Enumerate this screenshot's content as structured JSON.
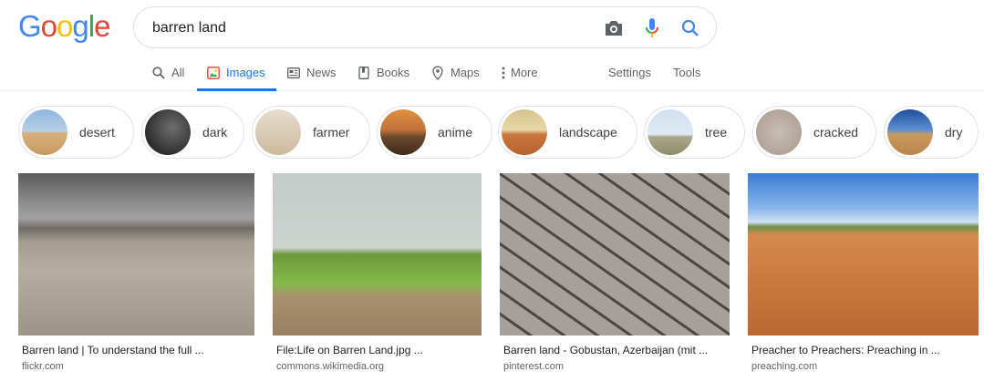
{
  "logo": {
    "letters": [
      "G",
      "o",
      "o",
      "g",
      "l",
      "e"
    ],
    "colors": [
      "#4285F4",
      "#EA4335",
      "#FBBC05",
      "#4285F4",
      "#34A853",
      "#EA4335"
    ]
  },
  "search": {
    "value": "barren land",
    "icons": [
      "camera-icon",
      "microphone-icon",
      "search-icon"
    ]
  },
  "tabs": [
    {
      "label": "All",
      "icon": "search-icon"
    },
    {
      "label": "Images",
      "icon": "images-icon",
      "active": true
    },
    {
      "label": "News",
      "icon": "news-icon"
    },
    {
      "label": "Books",
      "icon": "book-icon"
    },
    {
      "label": "Maps",
      "icon": "map-pin-icon"
    },
    {
      "label": "More",
      "icon": "more-vertical-icon"
    },
    {
      "label": "Settings"
    },
    {
      "label": "Tools"
    }
  ],
  "chips": [
    {
      "label": "desert"
    },
    {
      "label": "dark"
    },
    {
      "label": "farmer"
    },
    {
      "label": "anime"
    },
    {
      "label": "landscape"
    },
    {
      "label": "tree"
    },
    {
      "label": "cracked"
    },
    {
      "label": "dry"
    }
  ],
  "results": [
    {
      "title": "Barren land | To understand the full ...",
      "source": "flickr.com"
    },
    {
      "title": "File:Life on Barren Land.jpg ...",
      "source": "commons.wikimedia.org"
    },
    {
      "title": "Barren land - Gobustan, Azerbaijan (mit ...",
      "source": "pinterest.com"
    },
    {
      "title": "Preacher to Preachers: Preaching in ...",
      "source": "preaching.com"
    }
  ],
  "colors": {
    "accent": "#1a73e8",
    "text_secondary": "#5f6368",
    "border": "#dfe1e5"
  }
}
